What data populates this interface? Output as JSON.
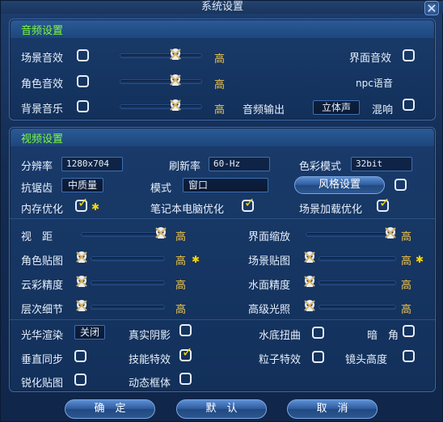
{
  "window": {
    "title": "系统设置",
    "close_icon": "✕"
  },
  "audio": {
    "title": "音频设置",
    "scene_sound": "场景音效",
    "role_sound": "角色音效",
    "bg_music": "背景音乐",
    "ui_sound": "界面音效",
    "npc_voice": "npc语音",
    "audio_output": "音频输出",
    "audio_output_value": "立体声",
    "reverb": "混响",
    "level_high": "高"
  },
  "video": {
    "title": "视频设置",
    "resolution_label": "分辨率",
    "resolution_value": "1280x704",
    "refresh_label": "刷新率",
    "refresh_value": "60-Hz",
    "color_label": "色彩模式",
    "color_value": "32bit",
    "aa_label": "抗锯齿",
    "aa_value": "中质量",
    "mode_label": "模式",
    "mode_value": "窗口",
    "style_btn": "风格设置",
    "mem_opt": "内存优化",
    "laptop_opt": "笔记本电脑优化",
    "scene_load_opt": "场景加载优化",
    "view_distance": "视　距",
    "ui_scale": "界面缩放",
    "role_texture": "角色贴图",
    "scene_texture": "场景贴图",
    "cloud_detail": "云彩精度",
    "water_detail": "水面精度",
    "lod": "层次细节",
    "hdr": "高级光照",
    "level_high": "高",
    "bloom": "光华渲染",
    "bloom_value": "关闭",
    "real_shadow": "真实阴影",
    "underwater": "水底扭曲",
    "dark_corner": "暗　角",
    "vsync": "垂直同步",
    "skill_fx": "技能特效",
    "particle_fx": "粒子特效",
    "cam_height": "镜头高度",
    "sharpen": "锐化贴图",
    "dyn_frame": "动态框体",
    "star": "✱"
  },
  "footer": {
    "ok": "确　定",
    "default": "默　认",
    "cancel": "取　消"
  }
}
